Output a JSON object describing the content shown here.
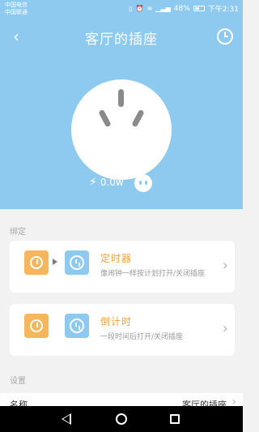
{
  "status_bar": {
    "carrier_1": "中国电信",
    "carrier_2": "中国联通",
    "battery": "48%",
    "time": "下午2:31"
  },
  "header": {
    "title": "客厅的插座"
  },
  "device": {
    "power": "0.0w"
  },
  "binding": {
    "label": "绑定",
    "items": [
      {
        "title": "定时器",
        "description": "像闹钟一样按计划打开/关闭插座"
      },
      {
        "title": "倒计时",
        "description": "一段时间后打开/关闭插座"
      }
    ]
  },
  "settings": {
    "label": "设置",
    "name_label": "名称",
    "name_value": "客厅的插座"
  },
  "colors": {
    "primary_blue": "#8ecaf0",
    "accent_orange": "#f6b65b",
    "title_orange": "#f0a33b"
  }
}
